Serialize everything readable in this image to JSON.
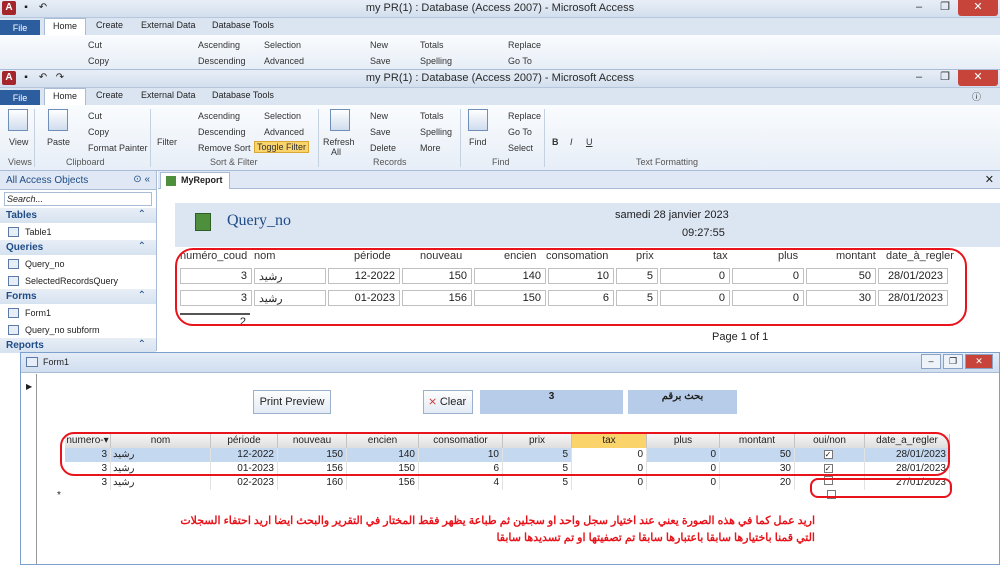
{
  "window": {
    "title": "my PR(1) : Database (Access 2007) - Microsoft Access"
  },
  "ribbon_tabs": [
    "File",
    "Home",
    "Create",
    "External Data",
    "Database Tools"
  ],
  "ribbon": {
    "views": {
      "view": "View",
      "group": "Views"
    },
    "clipboard": {
      "paste": "Paste",
      "cut": "Cut",
      "copy": "Copy",
      "format_painter": "Format Painter",
      "group": "Clipboard"
    },
    "sort_filter": {
      "filter": "Filter",
      "ascending": "Ascending",
      "descending": "Descending",
      "remove_sort": "Remove Sort",
      "selection": "Selection",
      "advanced": "Advanced",
      "toggle_filter": "Toggle Filter",
      "group": "Sort & Filter"
    },
    "records": {
      "refresh": "Refresh",
      "refresh_all": "All",
      "new": "New",
      "save": "Save",
      "delete": "Delete",
      "totals": "Totals",
      "spelling": "Spelling",
      "more": "More",
      "group": "Records"
    },
    "find": {
      "find": "Find",
      "replace": "Replace",
      "goto": "Go To",
      "select": "Select",
      "group": "Find"
    },
    "text_formatting": {
      "group": "Text Formatting",
      "bold": "B",
      "italic": "I",
      "underline": "U"
    }
  },
  "nav": {
    "header": "All Access Objects",
    "search_placeholder": "Search...",
    "sections": [
      {
        "title": "Tables",
        "items": [
          "Table1"
        ]
      },
      {
        "title": "Queries",
        "items": [
          "Query_no",
          "SelectedRecordsQuery"
        ]
      },
      {
        "title": "Forms",
        "items": [
          "Form1",
          "Query_no subform"
        ]
      },
      {
        "title": "Reports",
        "items": []
      }
    ]
  },
  "report": {
    "tab": "MyReport",
    "title": "Query_no",
    "date": "samedi 28 janvier 2023",
    "time": "09:27:55",
    "columns": [
      "numéro_coud",
      "nom",
      "période",
      "nouveau",
      "encien",
      "consomation",
      "prix",
      "tax",
      "plus",
      "montant",
      "date_à_regler"
    ],
    "rows": [
      [
        "3",
        "رشيد",
        "12-2022",
        "150",
        "140",
        "10",
        "5",
        "0",
        "0",
        "50",
        "28/01/2023"
      ],
      [
        "3",
        "رشيد",
        "01-2023",
        "156",
        "150",
        "6",
        "5",
        "0",
        "0",
        "30",
        "28/01/2023"
      ]
    ],
    "count": "2",
    "page": "Page 1 of 1"
  },
  "form": {
    "title": "Form1",
    "print_preview": "Print Preview",
    "clear": "Clear",
    "search_value": "3",
    "search_label": "بحث برقم",
    "columns": [
      "numero-▾",
      "nom",
      "période",
      "nouveau",
      "encien",
      "consomatior",
      "prix",
      "tax",
      "plus",
      "montant",
      "oui/non",
      "date_a_regler"
    ],
    "rows": [
      {
        "id": "3",
        "nom": "رشيد",
        "periode": "12-2022",
        "nouveau": "150",
        "encien": "140",
        "cons": "10",
        "prix": "5",
        "tax": "0",
        "plus": "0",
        "montant": "50",
        "oui": "✓",
        "date": "28/01/2023"
      },
      {
        "id": "3",
        "nom": "رشيد",
        "periode": "01-2023",
        "nouveau": "156",
        "encien": "150",
        "cons": "6",
        "prix": "5",
        "tax": "0",
        "plus": "0",
        "montant": "30",
        "oui": "✓",
        "date": "28/01/2023"
      },
      {
        "id": "3",
        "nom": "رشيد",
        "periode": "02-2023",
        "nouveau": "160",
        "encien": "156",
        "cons": "4",
        "prix": "5",
        "tax": "0",
        "plus": "0",
        "montant": "20",
        "oui": "",
        "date": "27/01/2023"
      }
    ],
    "new_marker": "*"
  },
  "annotation": {
    "line1": "اريد عمل كما في هذه الصورة يعني عند اختيار سجل واحد او سجلين ثم طباعة يظهر فقط المختار في التقرير والبحث ايضا اريد احتفاء السجلات",
    "line2": "التي قمنا باختيارها سابقا باعتبارها سابقا تم تصفيتها او تم تسديدها سابقا"
  }
}
